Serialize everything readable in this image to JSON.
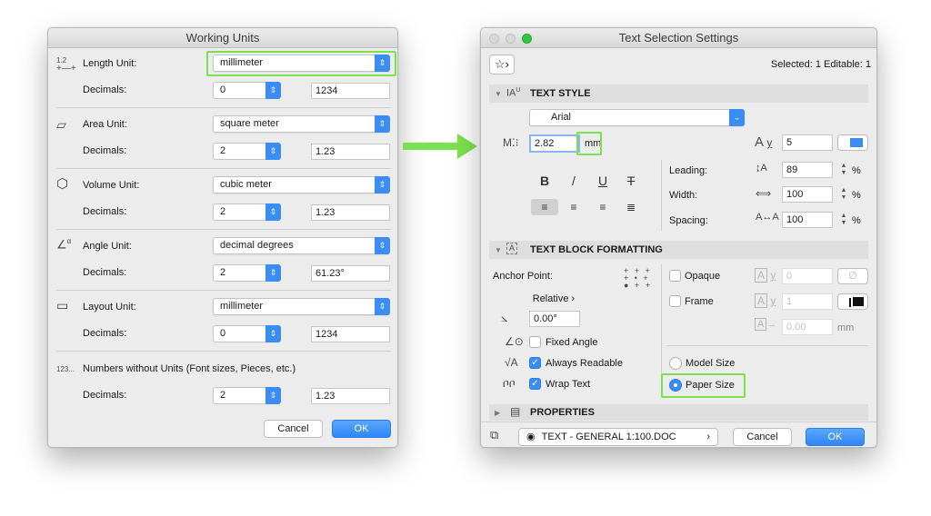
{
  "colors": {
    "accent": "#3b8df6",
    "highlight": "#7be24f",
    "arrow": "#7be24f"
  },
  "working_units": {
    "title": "Working Units",
    "rows": [
      {
        "icon": "length-unit-icon",
        "icon_text": "1.2",
        "label": "Length Unit:",
        "unit": "millimeter",
        "decimals_label": "Decimals:",
        "decimals": "0",
        "preview": "1234"
      },
      {
        "icon": "area-unit-icon",
        "label": "Area Unit:",
        "unit": "square meter",
        "decimals_label": "Decimals:",
        "decimals": "2",
        "preview": "1.23"
      },
      {
        "icon": "volume-unit-icon",
        "label": "Volume Unit:",
        "unit": "cubic meter",
        "decimals_label": "Decimals:",
        "decimals": "2",
        "preview": "1.23"
      },
      {
        "icon": "angle-unit-icon",
        "icon_text": "α",
        "label": "Angle Unit:",
        "unit": "decimal degrees",
        "decimals_label": "Decimals:",
        "decimals": "2",
        "preview": "61.23°"
      },
      {
        "icon": "layout-unit-icon",
        "label": "Layout Unit:",
        "unit": "millimeter",
        "decimals_label": "Decimals:",
        "decimals": "0",
        "preview": "1234"
      }
    ],
    "numbers": {
      "icon_text": "123...",
      "label": "Numbers without Units (Font sizes, Pieces, etc.)",
      "decimals_label": "Decimals:",
      "decimals": "2",
      "preview": "1.23"
    },
    "cancel": "Cancel",
    "ok": "OK"
  },
  "text_selection": {
    "title": "Text Selection Settings",
    "selected_info": "Selected: 1 Editable: 1",
    "text_style": {
      "header": "TEXT STYLE",
      "font": "Arial",
      "size": "2.82",
      "size_unit": "mm",
      "pen": "5",
      "bold": "B",
      "italic": "/",
      "underline": "U",
      "strike": "T",
      "leading_label": "Leading:",
      "leading": "89",
      "width_label": "Width:",
      "width": "100",
      "spacing_label": "Spacing:",
      "spacing": "100",
      "percent": "%"
    },
    "text_block": {
      "header": "TEXT BLOCK FORMATTING",
      "anchor_label": "Anchor Point:",
      "relative": "Relative",
      "angle": "0.00°",
      "fixed_angle": "Fixed Angle",
      "always_readable": "Always Readable",
      "wrap_text": "Wrap Text",
      "opaque": "Opaque",
      "frame": "Frame",
      "opaque_pen": "0",
      "frame_pen": "1",
      "frame_offset": "0.00",
      "frame_offset_unit": "mm",
      "model_size": "Model Size",
      "paper_size": "Paper Size"
    },
    "properties": {
      "header": "PROPERTIES"
    },
    "layer": "TEXT - GENERAL 1:100.DOC",
    "cancel": "Cancel",
    "ok": "OK"
  }
}
